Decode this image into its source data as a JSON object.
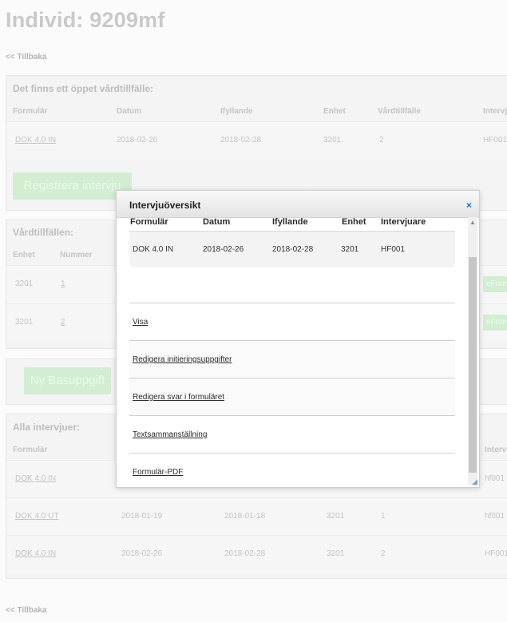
{
  "page": {
    "title": "Individ: 9209mf",
    "back_top": "<< Tillbaka",
    "back_bottom": "<< Tillbaka"
  },
  "open_visit": {
    "title": "Det finns ett öppet vårdtillfälle:",
    "headers": [
      "Formulär",
      "Datum",
      "Ifyllande",
      "Enhet",
      "Vårdtillfälle",
      "Intervj"
    ],
    "row": [
      "DOK 4.0 IN",
      "2018-02-26",
      "2018-02-28",
      "3201",
      "2",
      "HF001"
    ],
    "register_button": "Registrera intervju"
  },
  "visits": {
    "title": "Vårdtillfällen:",
    "headers": [
      "Enhet",
      "Nummer"
    ],
    "rows": [
      {
        "unit": "3201",
        "number": "1",
        "action": "eForm"
      },
      {
        "unit": "3201",
        "number": "2",
        "action": "eForm"
      }
    ],
    "new_task_button": "Ny Basuppgift"
  },
  "all_interviews": {
    "title": "Alla intervjuer:",
    "headers": [
      "Formulär",
      "Interv"
    ],
    "rows": [
      {
        "form": "DOK 4.0 IN",
        "date": "",
        "filled": "",
        "unit": "",
        "visit": "",
        "interviewer": "hf001"
      },
      {
        "form": "DOK 4.0 UT",
        "date": "2018-01-19",
        "filled": "2018-01-18",
        "unit": "3201",
        "visit": "1",
        "interviewer": "hf001"
      },
      {
        "form": "DOK 4.0 IN",
        "date": "2018-02-26",
        "filled": "2018-02-28",
        "unit": "3201",
        "visit": "2",
        "interviewer": "HF001"
      }
    ]
  },
  "modal": {
    "title": "Intervjuöversikt",
    "close_icon": "×",
    "headers": {
      "form": "Formulär",
      "date": "Datum",
      "filled": "Ifyllande",
      "unit": "Enhet",
      "interviewer": "Intervjuare"
    },
    "row": {
      "form": "DOK 4.0 IN",
      "date": "2018-02-26",
      "filled": "2018-02-28",
      "unit": "3201",
      "interviewer": "HF001"
    },
    "menu": [
      "Visa",
      "Redigera initieringsuppgifter",
      "Redigera svar i formuläret",
      "Textsammanställning",
      "Formulär-PDF"
    ],
    "resize_glyph": "◢"
  },
  "colors": {
    "accent_green": "#d2edd2",
    "close_blue": "#1e6fd1"
  }
}
